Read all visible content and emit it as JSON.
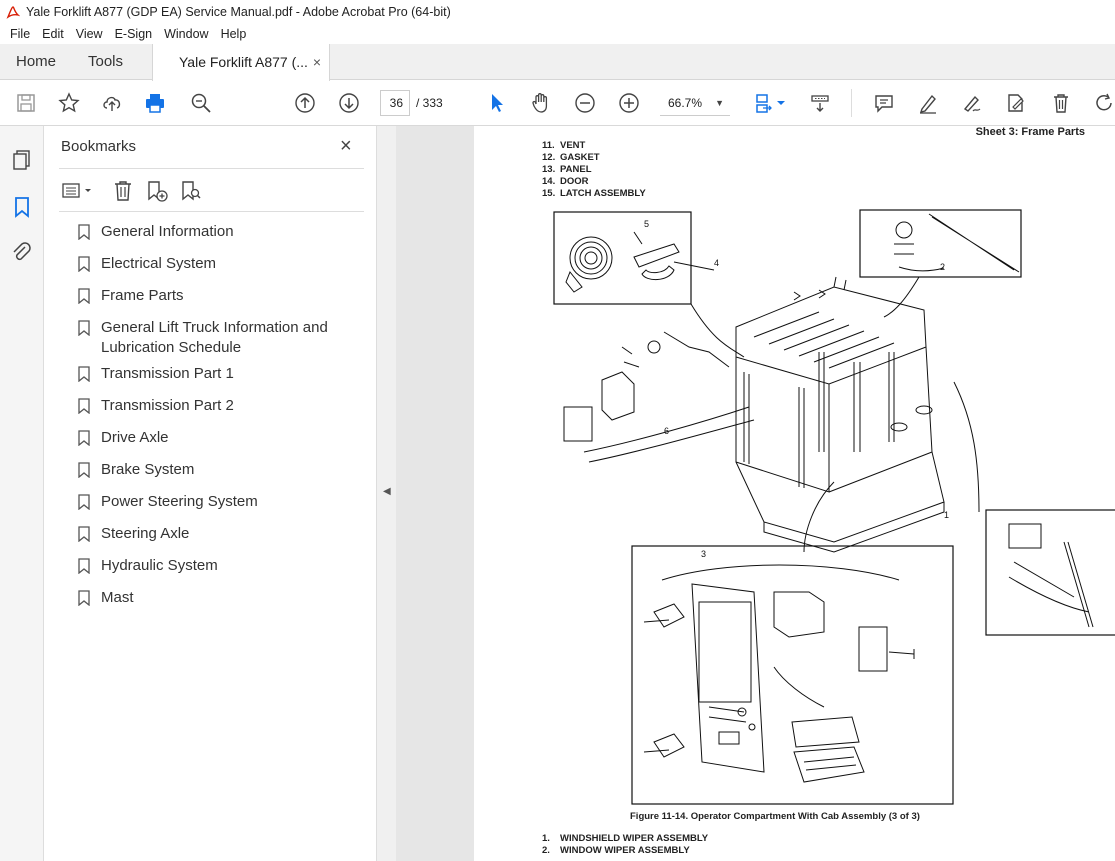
{
  "window": {
    "title": "Yale Forklift A877 (GDP EA) Service Manual.pdf - Adobe Acrobat Pro (64-bit)"
  },
  "menu": [
    "File",
    "Edit",
    "View",
    "E-Sign",
    "Window",
    "Help"
  ],
  "tabs": {
    "home": "Home",
    "tools": "Tools",
    "doc": "Yale Forklift A877 (...",
    "close": "×"
  },
  "toolbar": {
    "page_current": "36",
    "page_total": "/ 333",
    "zoom": "66.7%"
  },
  "bookmarks": {
    "title": "Bookmarks",
    "close": "×",
    "items": [
      "General Information",
      "Electrical System",
      "Frame Parts",
      "General Lift Truck Information and Lubrication Schedule",
      "Transmission Part 1",
      "Transmission Part 2",
      "Drive Axle",
      "Brake System",
      "Power Steering System",
      "Steering Axle",
      "Hydraulic System",
      "Mast"
    ]
  },
  "pdf": {
    "sheet_title": "Sheet 3: Frame Parts",
    "legend_top": [
      {
        "num": "11.",
        "label": "VENT"
      },
      {
        "num": "12.",
        "label": "GASKET"
      },
      {
        "num": "13.",
        "label": "PANEL"
      },
      {
        "num": "14.",
        "label": "DOOR"
      },
      {
        "num": "15.",
        "label": "LATCH ASSEMBLY"
      }
    ],
    "callouts": [
      "1",
      "2",
      "3",
      "4",
      "5",
      "6"
    ],
    "caption": "Figure 11-14. Operator Compartment With Cab Assembly (3 of 3)",
    "legend_bottom": [
      {
        "num": "1.",
        "label": "WINDSHIELD WIPER ASSEMBLY"
      },
      {
        "num": "2.",
        "label": "WINDOW WIPER ASSEMBLY"
      }
    ]
  }
}
